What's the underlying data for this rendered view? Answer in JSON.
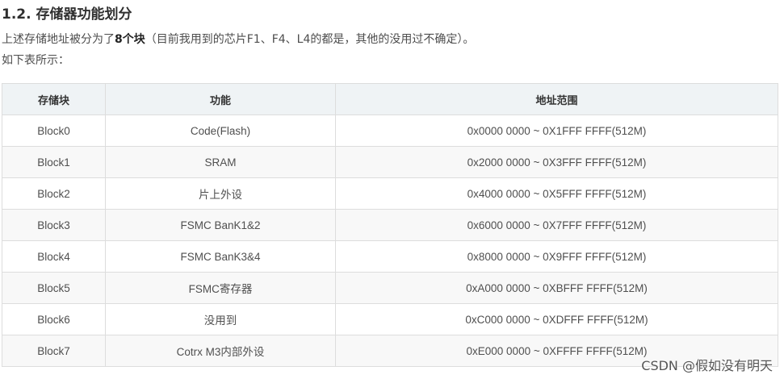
{
  "heading": "1.2. 存储器功能划分",
  "intro": {
    "before": "上述存储地址被分为了",
    "bold": "8个块",
    "after": "（目前我用到的芯片F1、F4、L4的都是，其他的没用过不确定）。"
  },
  "intro2": "如下表所示：",
  "table": {
    "headers": [
      "存储块",
      "功能",
      "地址范围"
    ],
    "rows": [
      [
        "Block0",
        "Code(Flash)",
        "0x0000 0000 ~ 0X1FFF FFFF(512M)"
      ],
      [
        "Block1",
        "SRAM",
        "0x2000 0000 ~ 0X3FFF FFFF(512M)"
      ],
      [
        "Block2",
        "片上外设",
        "0x4000 0000 ~ 0X5FFF FFFF(512M)"
      ],
      [
        "Block3",
        "FSMC BanK1&2",
        "0x6000 0000 ~ 0X7FFF FFFF(512M)"
      ],
      [
        "Block4",
        "FSMC BanK3&4",
        "0x8000 0000 ~ 0X9FFF FFFF(512M)"
      ],
      [
        "Block5",
        "FSMC寄存器",
        "0xA000 0000 ~ 0XBFFF FFFF(512M)"
      ],
      [
        "Block6",
        "没用到",
        "0xC000 0000 ~ 0XDFFF FFFF(512M)"
      ],
      [
        "Block7",
        "Cotrx M3内部外设",
        "0xE000 0000 ~ 0XFFFF FFFF(512M)"
      ]
    ]
  },
  "watermark": "CSDN @假如没有明天"
}
